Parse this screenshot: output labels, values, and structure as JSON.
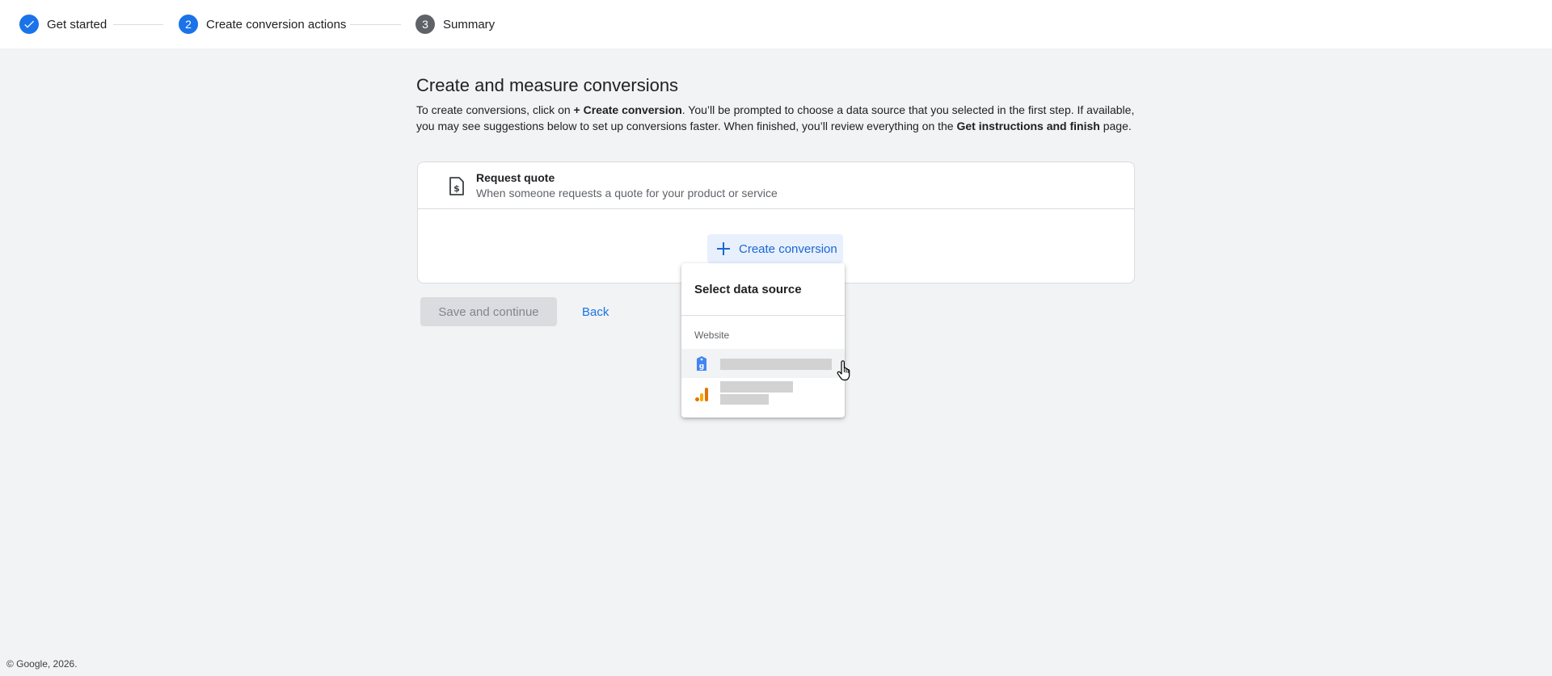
{
  "stepper": {
    "steps": [
      {
        "number": "",
        "label": "Get started",
        "state": "done"
      },
      {
        "number": "2",
        "label": "Create conversion actions",
        "state": "active"
      },
      {
        "number": "3",
        "label": "Summary",
        "state": "pending"
      }
    ]
  },
  "main": {
    "title": "Create and measure conversions",
    "desc_part1": "To create conversions, click on ",
    "desc_bold1": "+ Create conversion",
    "desc_part2": ". You’ll be prompted to choose a data source that you selected in the first step. If available, you may see suggestions below to set up conversions faster. When finished, you’ll review everything on the ",
    "desc_bold2": "Get instructions and finish",
    "desc_part3": " page."
  },
  "card": {
    "title": "Request quote",
    "subtitle": "When someone requests a quote for your product or service",
    "create_button": "Create conversion"
  },
  "actions": {
    "save_label": "Save and continue",
    "back_label": "Back"
  },
  "dropdown": {
    "title": "Select data source",
    "section": "Website",
    "items": [
      {
        "icon": "google-tag-icon"
      },
      {
        "icon": "google-analytics-icon"
      }
    ]
  },
  "footer": {
    "copyright": "© Google, 2026."
  },
  "colors": {
    "accent": "#1a73e8",
    "background": "#f1f3f4",
    "analytics_orange": "#f9ab00",
    "analytics_dark_orange": "#e37400"
  }
}
